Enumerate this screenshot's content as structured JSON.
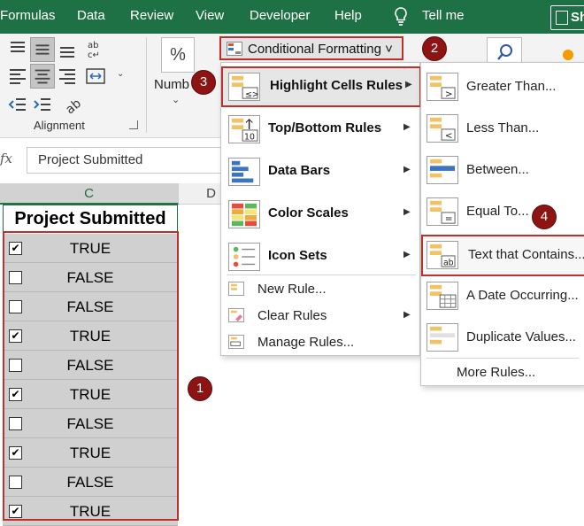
{
  "ribbon_tabs": [
    "Formulas",
    "Data",
    "Review",
    "View",
    "Developer",
    "Help",
    "Tell me"
  ],
  "share_label": "Sh",
  "alignment_group_label": "Alignment",
  "number_group_label": "Numb",
  "percent_symbol": "%",
  "conditional_formatting_label": "Conditional Formatting",
  "formula_bar": {
    "fx_label": "fx",
    "value": "Project Submitted"
  },
  "column_headers": [
    "C",
    "D"
  ],
  "table": {
    "header": "Project Submitted",
    "rows": [
      {
        "checked": "✔",
        "value": "TRUE"
      },
      {
        "checked": "",
        "value": "FALSE"
      },
      {
        "checked": "",
        "value": "FALSE"
      },
      {
        "checked": "✔",
        "value": "TRUE"
      },
      {
        "checked": "",
        "value": "FALSE"
      },
      {
        "checked": "✔",
        "value": "TRUE"
      },
      {
        "checked": "",
        "value": "FALSE"
      },
      {
        "checked": "✔",
        "value": "TRUE"
      },
      {
        "checked": "",
        "value": "FALSE"
      },
      {
        "checked": "✔",
        "value": "TRUE"
      }
    ]
  },
  "cf_menu": {
    "items": [
      {
        "label": "Highlight Cells Rules",
        "icon": "highlight-cells-icon"
      },
      {
        "label": "Top/Bottom Rules",
        "icon": "top-bottom-icon"
      },
      {
        "label": "Data Bars",
        "icon": "data-bars-icon"
      },
      {
        "label": "Color Scales",
        "icon": "color-scales-icon"
      },
      {
        "label": "Icon Sets",
        "icon": "icon-sets-icon"
      }
    ],
    "simple_items": [
      {
        "label": "New Rule...",
        "icon": "new-rule-icon"
      },
      {
        "label": "Clear Rules",
        "icon": "clear-rules-icon"
      },
      {
        "label": "Manage Rules...",
        "icon": "manage-rules-icon"
      }
    ]
  },
  "highlight_submenu": {
    "items": [
      {
        "label": "Greater Than...",
        "icon_glyph": ">"
      },
      {
        "label": "Less Than...",
        "icon_glyph": "<"
      },
      {
        "label": "Between...",
        "icon_glyph": ""
      },
      {
        "label": "Equal To...",
        "icon_glyph": "="
      },
      {
        "label": "Text that Contains...",
        "icon_glyph": "ab"
      },
      {
        "label": "A Date Occurring...",
        "icon_glyph": ""
      },
      {
        "label": "Duplicate Values...",
        "icon_glyph": ""
      }
    ],
    "more_rules": "More Rules..."
  },
  "callouts": [
    "1",
    "2",
    "3",
    "4"
  ],
  "colors": {
    "excel_green": "#1e7145",
    "callout_red": "#8e1313",
    "highlight_border": "#c0302a"
  }
}
